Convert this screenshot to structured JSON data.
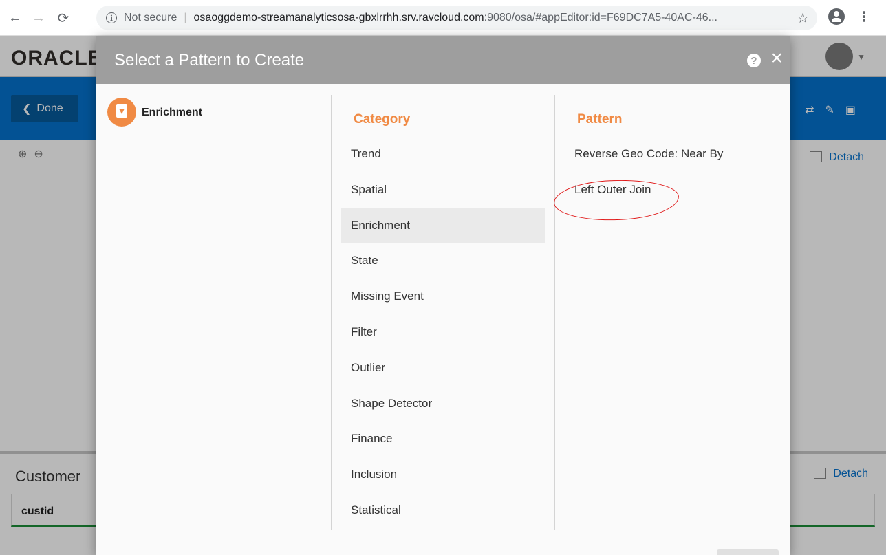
{
  "browser": {
    "url_security": "Not secure",
    "url_host": "osaoggdemo-streamanalyticsosa-gbxlrrhh.srv.ravcloud.com",
    "url_path": ":9080/osa/#appEditor:id=F69DC7A5-40AC-46..."
  },
  "app": {
    "logo": "ORACLE",
    "done_label": "Done",
    "detach_label": "Detach",
    "table_title": "Customer",
    "table_column": "custid"
  },
  "modal": {
    "title": "Select a Pattern to Create",
    "help_symbol": "?",
    "close_symbol": "×",
    "selected_group": "Enrichment",
    "category_heading": "Category",
    "pattern_heading": "Pattern",
    "categories": [
      "Trend",
      "Spatial",
      "Enrichment",
      "State",
      "Missing Event",
      "Filter",
      "Outlier",
      "Shape Detector",
      "Finance",
      "Inclusion",
      "Statistical"
    ],
    "selected_category": "Enrichment",
    "patterns": [
      "Reverse Geo Code: Near By",
      "Left Outer Join"
    ]
  },
  "colors": {
    "accent_orange": "#f08a44",
    "toolbar_blue": "#0572ce",
    "annotation_red": "#e01818"
  }
}
